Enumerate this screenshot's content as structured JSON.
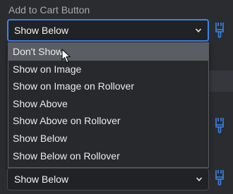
{
  "field": {
    "label": "Add to Cart Button",
    "selected": "Show Below",
    "options": [
      "Don't Show",
      "Show on Image",
      "Show on Image on Rollover",
      "Show Above",
      "Show Above on Rollover",
      "Show Below",
      "Show Below on Rollover"
    ],
    "hovered_index": 0
  },
  "second_field": {
    "selected": "Show Below"
  },
  "colors": {
    "background": "#2a2c30",
    "focus_border": "#3b84e6",
    "brush_icon": "#3b84e6",
    "hover_row": "#5a5d63"
  },
  "icons": [
    "chevron-down-icon",
    "paintbrush-icon",
    "mouse-cursor-icon"
  ]
}
